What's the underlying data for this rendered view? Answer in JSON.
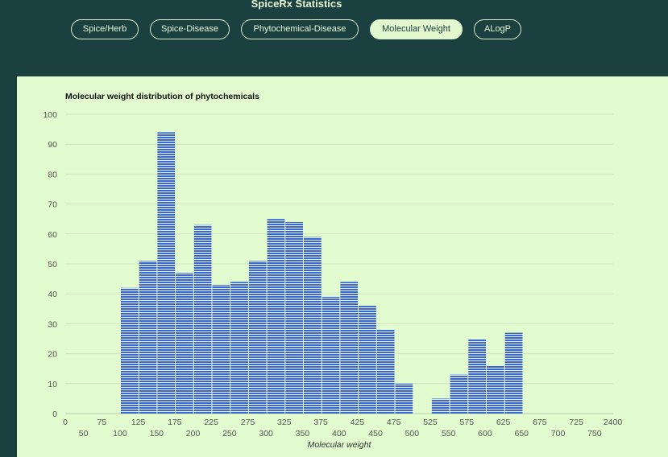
{
  "page": {
    "title": "SpiceRx Statistics"
  },
  "tabs": [
    {
      "label": "Spice/Herb",
      "active": false
    },
    {
      "label": "Spice-Disease",
      "active": false
    },
    {
      "label": "Phytochemical-Disease",
      "active": false
    },
    {
      "label": "Molecular Weight",
      "active": true
    },
    {
      "label": "ALogP",
      "active": false
    }
  ],
  "colors": {
    "background": "#1b4040",
    "panel": "#e2fcd0",
    "bar": "#3a69c9",
    "bar_stripe": "#ffffff"
  },
  "chart_data": {
    "type": "bar",
    "title": "Molecular weight distribution of phytochemicals",
    "xlabel": "Molecular weight",
    "ylabel": "",
    "ylim": [
      0,
      100
    ],
    "yticks": [
      "0",
      "10",
      "20",
      "30",
      "40",
      "50",
      "60",
      "70",
      "80",
      "90",
      "100"
    ],
    "xtick_labels": [
      "0",
      "50",
      "75",
      "100",
      "125",
      "150",
      "175",
      "200",
      "225",
      "250",
      "275",
      "300",
      "325",
      "350",
      "375",
      "400",
      "425",
      "450",
      "475",
      "500",
      "525",
      "550",
      "575",
      "600",
      "625",
      "650",
      "675",
      "700",
      "725",
      "750",
      "2400"
    ],
    "bin_edges": [
      100,
      125,
      150,
      175,
      200,
      225,
      250,
      275,
      300,
      325,
      350,
      375,
      400,
      425,
      450,
      475,
      500,
      525,
      550,
      575,
      600,
      625,
      650
    ],
    "values": [
      42,
      51,
      94,
      47,
      63,
      43,
      44,
      51,
      65,
      64,
      59,
      39,
      44,
      36,
      28,
      10,
      0,
      5,
      13,
      25,
      16,
      27
    ]
  }
}
